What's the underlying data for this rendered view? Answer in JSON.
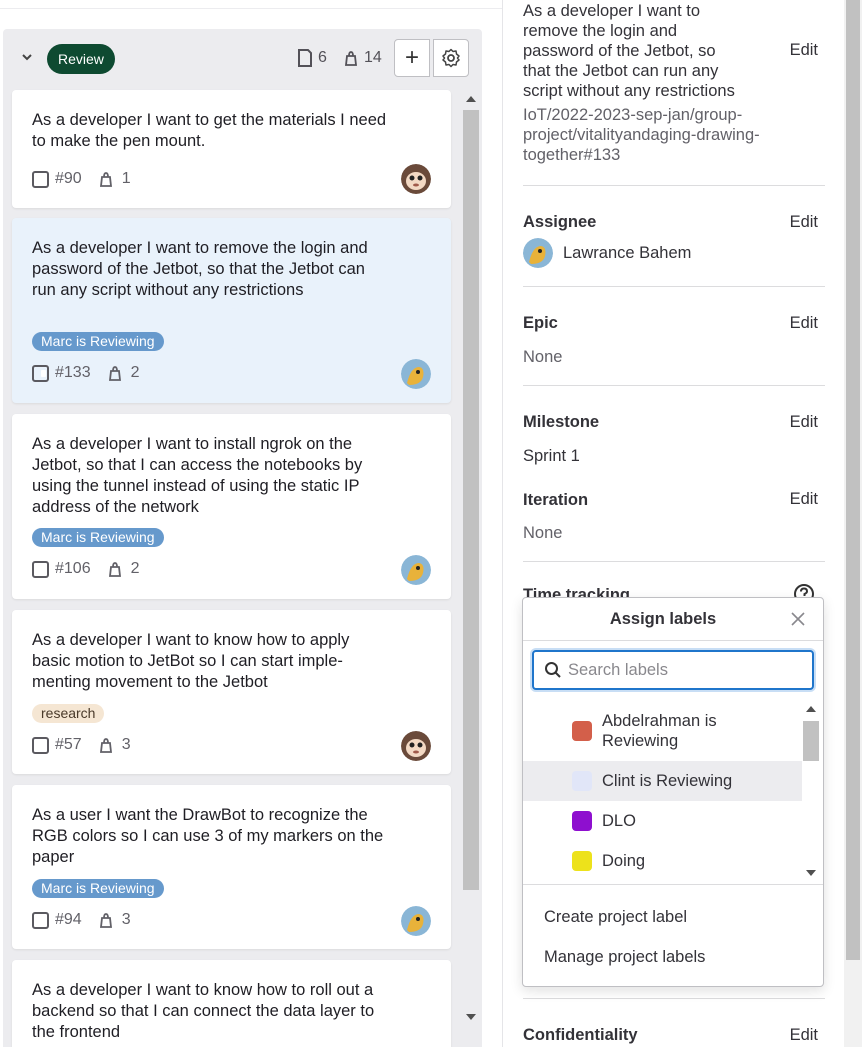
{
  "column": {
    "name": "Review",
    "issue_count": "6",
    "weight_total": "14",
    "add_label": "+"
  },
  "cards": [
    {
      "title": "As a developer I want to get the materials I need to make the pen mount.",
      "number": "#90",
      "weight": "1",
      "label": "",
      "avatar": "monkey"
    },
    {
      "title": "As a developer I want to remove the login and password of the Jetbot, so that the Jetbot can run any script without any restrictions",
      "number": "#133",
      "weight": "2",
      "label": "Marc is Reviewing",
      "avatar": "bird"
    },
    {
      "title": "As a developer I want to install ngrok on the Jetbot, so that I can access the notebooks by using the tunnel instead of using the static IP address of the network",
      "number": "#106",
      "weight": "2",
      "label": "Marc is Reviewing",
      "avatar": "bird"
    },
    {
      "title": "As a developer I want to know how to apply basic motion to JetBot so I can start imple-menting movement to the Jetbot",
      "number": "#57",
      "weight": "3",
      "label": "research",
      "avatar": "monkey"
    },
    {
      "title": "As a user I want the DrawBot to recognize the RGB colors so I can use 3 of my markers on the paper",
      "number": "#94",
      "weight": "3",
      "label": "Marc is Reviewing",
      "avatar": "bird"
    },
    {
      "title": "As a developer I want to know how to roll out a backend so that I can connect the data layer to the frontend",
      "number": "",
      "weight": "",
      "label": "",
      "avatar": ""
    }
  ],
  "sidebar": {
    "title_lines": [
      "As a developer I want to",
      "remove the login and",
      "password of the Jetbot, so",
      "that the Jetbot can run any",
      "script without any restrictions"
    ],
    "reference_lines": [
      "IoT/2022-2023-sep-jan/group-",
      "project/vitalityandaging-drawing-",
      "together#133"
    ],
    "edit": "Edit",
    "assignee_heading": "Assignee",
    "assignee_name": "Lawrance Bahem",
    "epic_heading": "Epic",
    "epic_value": "None",
    "milestone_heading": "Milestone",
    "milestone_value": "Sprint 1",
    "iteration_heading": "Iteration",
    "iteration_value": "None",
    "time_tracking_heading": "Time tracking",
    "confidentiality_heading": "Confidentiality"
  },
  "dropdown": {
    "title": "Assign labels",
    "search_placeholder": "Search labels",
    "labels": [
      {
        "name_lines": [
          "Abdelrahman is",
          "Reviewing"
        ],
        "color": "#d35f4a"
      },
      {
        "name_lines": [
          "Clint is Reviewing"
        ],
        "color": "#e1e6f8"
      },
      {
        "name_lines": [
          "DLO"
        ],
        "color": "#8e0fcf"
      },
      {
        "name_lines": [
          "Doing"
        ],
        "color": "#ede21b"
      }
    ],
    "create_label": "Create project label",
    "manage_label": "Manage project labels"
  },
  "colors": {
    "stage_badge": "#0e4a31",
    "label_marc": "#6699cc",
    "label_research": "#f5e6d3",
    "selected_card": "#e9f2fb",
    "focus_ring": "#1f75cb"
  }
}
